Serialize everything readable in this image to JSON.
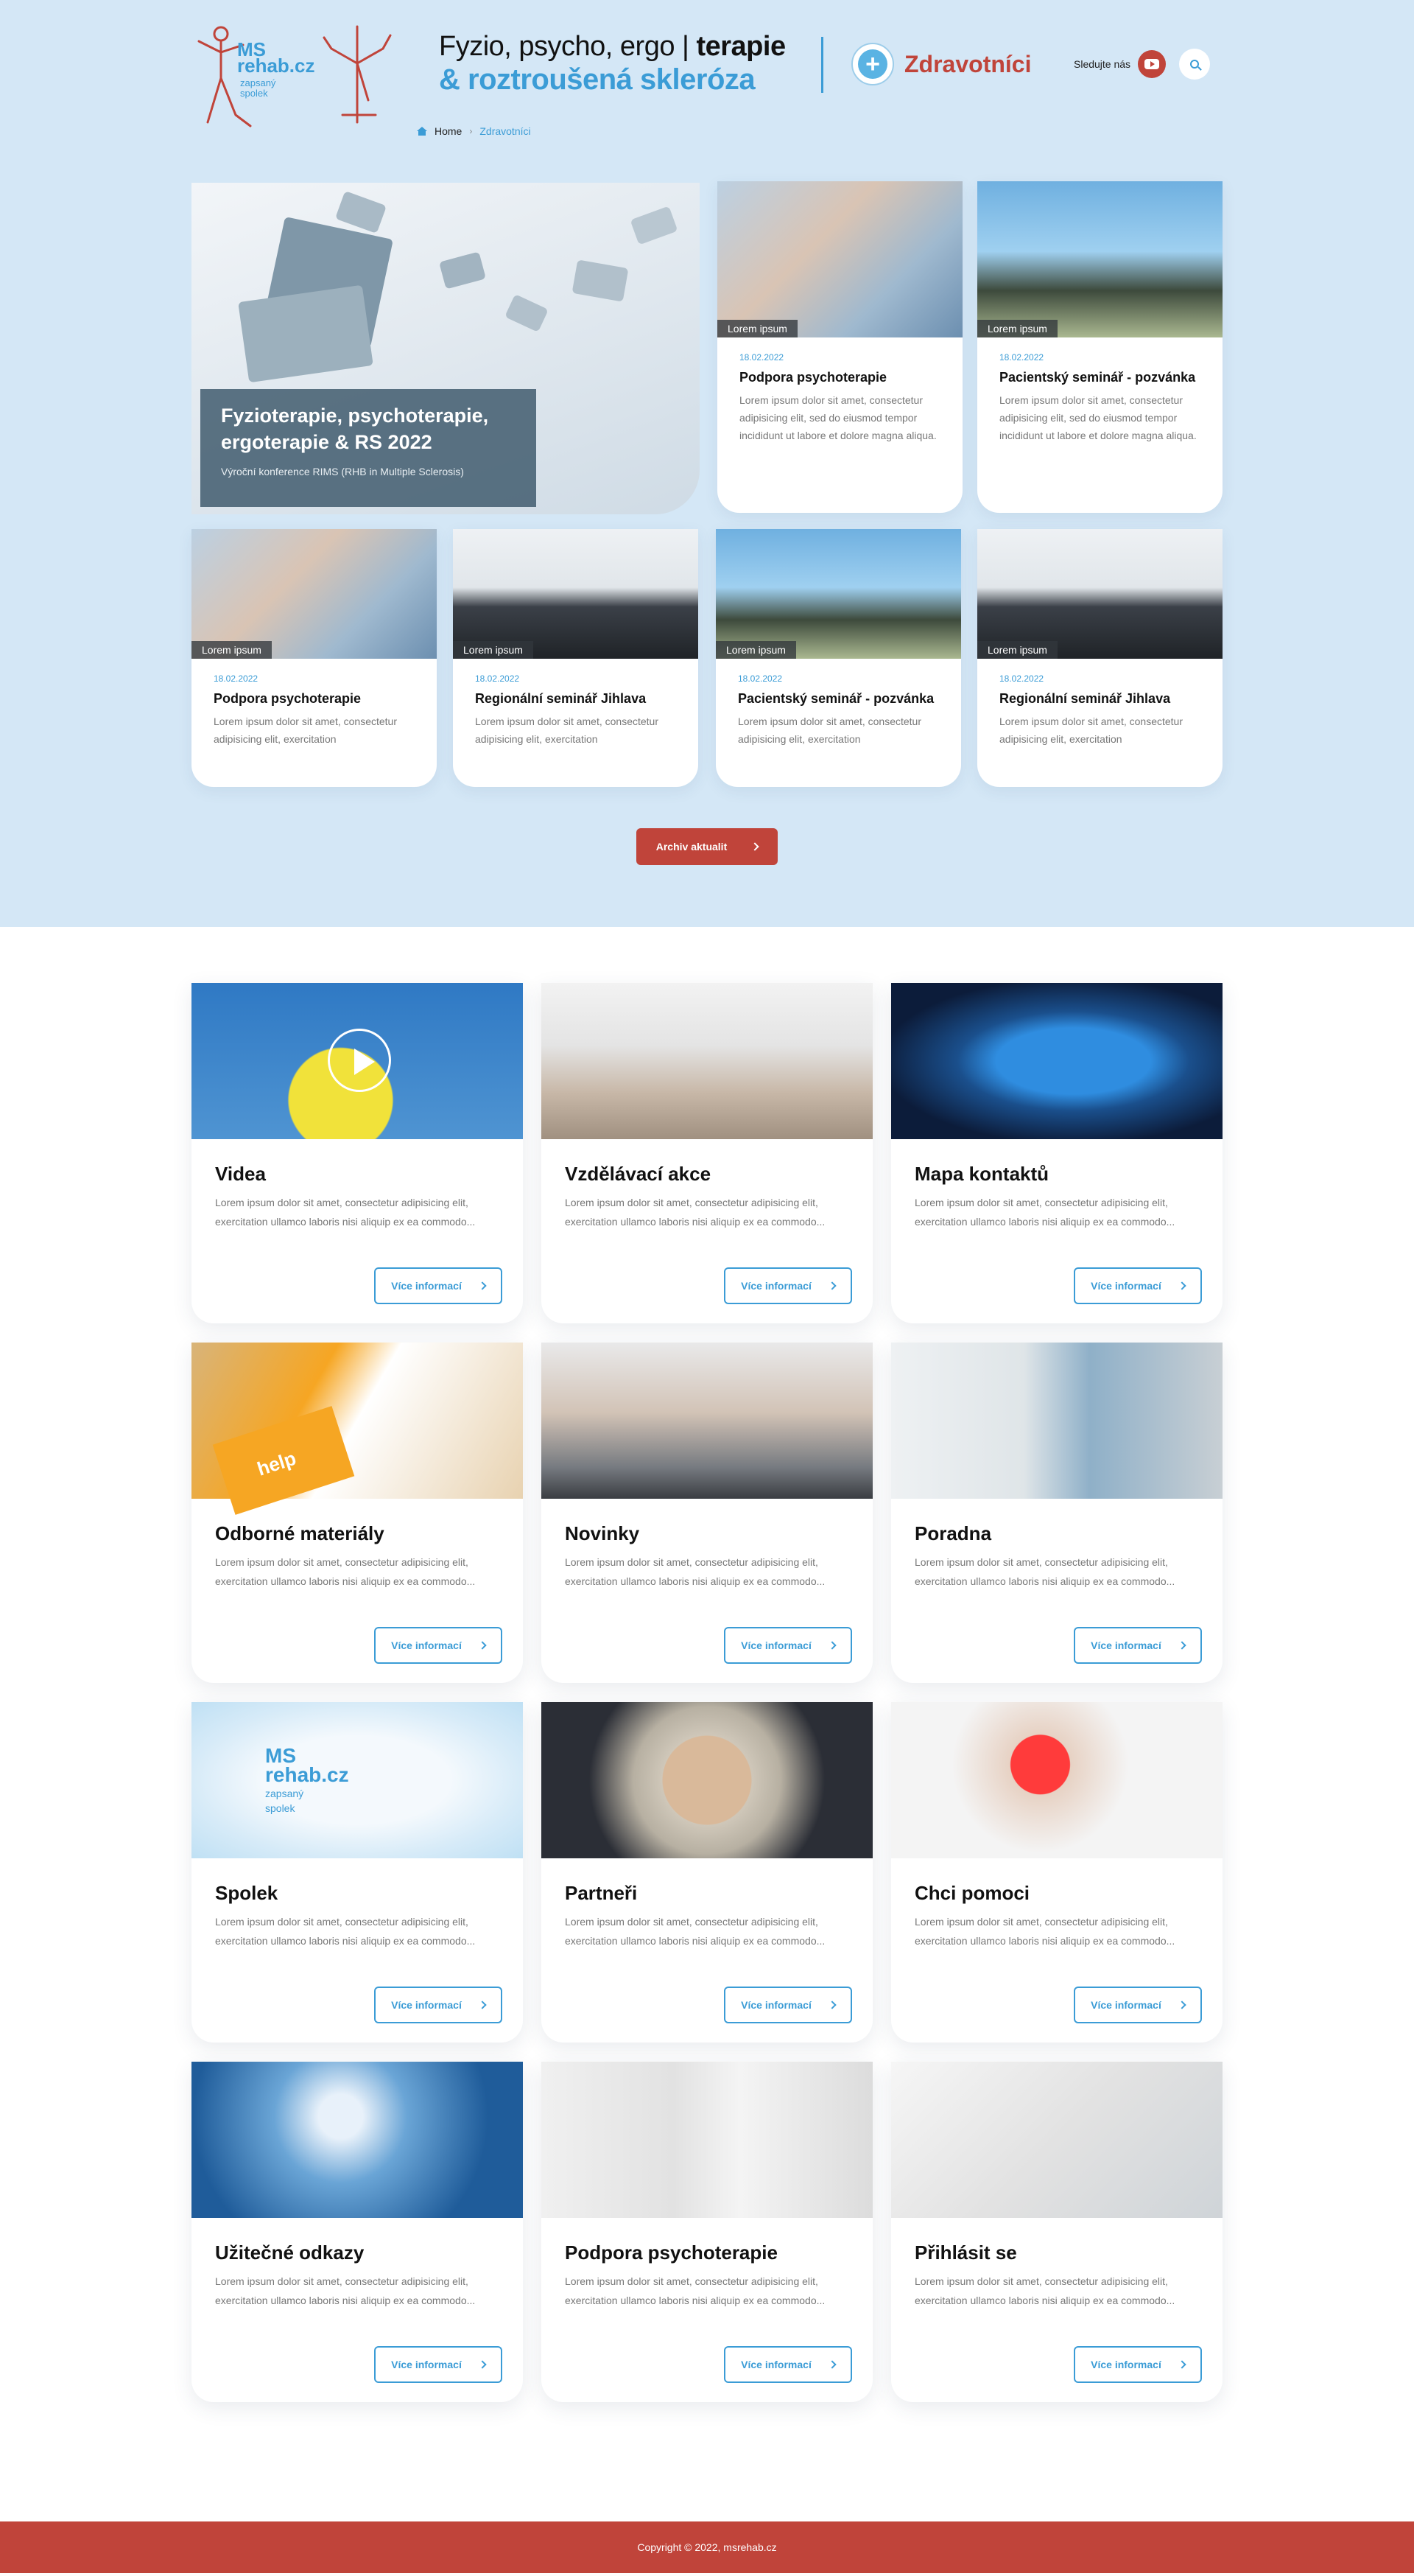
{
  "header": {
    "logo": {
      "line1": "MS",
      "line2": "rehab.cz",
      "line3": "zapsaný",
      "line4": "spolek"
    },
    "title_line1_regular": "Fyzio, psycho, ergo | ",
    "title_line1_bold": "terapie",
    "title_line2": "& roztroušená skleróza",
    "section_label": "Zdravotníci",
    "follow_text": "Sledujte nás"
  },
  "breadcrumb": {
    "home": "Home",
    "separator": "›",
    "current": "Zdravotníci"
  },
  "featured": {
    "title": "Fyzioterapie, psychoterapie, ergoterapie & RS 2022",
    "subtitle": "Výroční konference RIMS (RHB in Multiple Sclerosis)"
  },
  "news_top": [
    {
      "tag": "Lorem ipsum",
      "date": "18.02.2022",
      "title": "Podpora psychoterapie",
      "text": "Lorem ipsum dolor sit amet, consectetur adipisicing elit, sed do eiusmod tempor incididunt ut labore et dolore magna aliqua."
    },
    {
      "tag": "Lorem ipsum",
      "date": "18.02.2022",
      "title": "Pacientský seminář - pozvánka",
      "text": "Lorem ipsum dolor sit amet, consectetur adipisicing elit, sed do eiusmod tempor incididunt ut labore et dolore magna aliqua."
    }
  ],
  "news_bottom": [
    {
      "tag": "Lorem ipsum",
      "date": "18.02.2022",
      "title": "Podpora psychoterapie",
      "text": "Lorem ipsum dolor sit amet, consectetur adipisicing elit, exercitation"
    },
    {
      "tag": "Lorem ipsum",
      "date": "18.02.2022",
      "title": "Regionální seminář Jihlava",
      "text": "Lorem ipsum dolor sit amet, consectetur adipisicing elit, exercitation"
    },
    {
      "tag": "Lorem ipsum",
      "date": "18.02.2022",
      "title": "Pacientský seminář - pozvánka",
      "text": "Lorem ipsum dolor sit amet, consectetur adipisicing elit, exercitation"
    },
    {
      "tag": "Lorem ipsum",
      "date": "18.02.2022",
      "title": "Regionální seminář Jihlava",
      "text": "Lorem ipsum dolor sit amet, consectetur adipisicing elit, exercitation"
    }
  ],
  "archive_button": "Archiv aktualit",
  "services": {
    "button_label": "Více informací",
    "text": "Lorem ipsum dolor sit amet, consectetur adipisicing elit, exercitation ullamco laboris nisi aliquip ex ea commodo...",
    "items": [
      {
        "title": "Videa"
      },
      {
        "title": "Vzdělávací akce"
      },
      {
        "title": "Mapa kontaktů"
      },
      {
        "title": "Odborné materiály"
      },
      {
        "title": "Novinky"
      },
      {
        "title": "Poradna"
      },
      {
        "title": "Spolek"
      },
      {
        "title": "Partneři"
      },
      {
        "title": "Chci pomoci"
      },
      {
        "title": "Užitečné odkazy"
      },
      {
        "title": "Podpora psychoterapie"
      },
      {
        "title": "Přihlásit se"
      }
    ]
  },
  "brochure_label": "help",
  "footer": {
    "copyright": "Copyright © 2022, msrehab.cz"
  },
  "colors": {
    "primary_blue": "#3b9cd6",
    "accent_red": "#c0443a",
    "hero_background": "#d4e7f6"
  }
}
